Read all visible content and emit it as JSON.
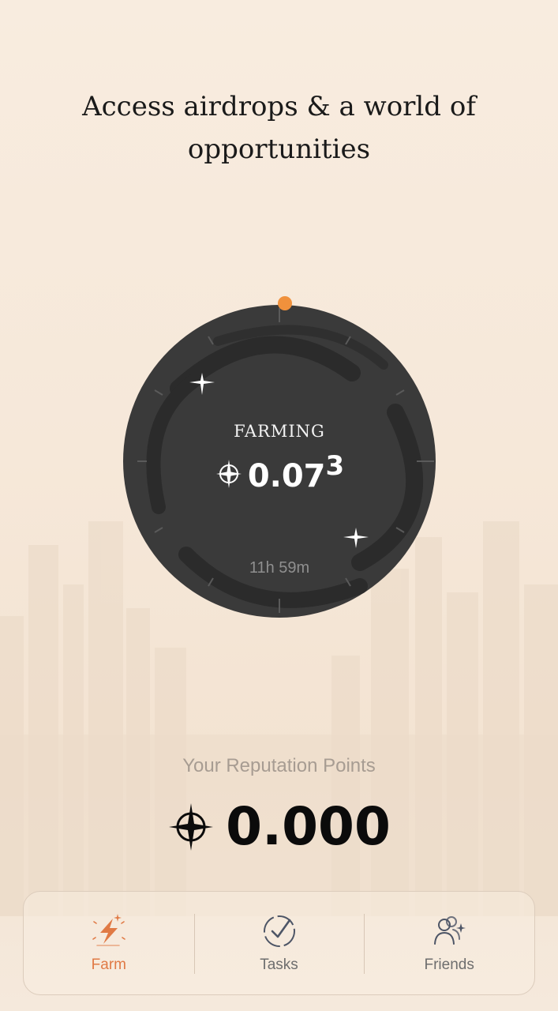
{
  "headline": {
    "line1": "Access airdrops & a world of",
    "line2": "opportunities"
  },
  "dial": {
    "status": "FARMING",
    "value": "0.07",
    "value_superscript": "3",
    "timer": "11h 59m",
    "coin_icon": "sparkle-coin-icon",
    "progress_dot_color": "#f0913c",
    "face_color": "#3a3a3a"
  },
  "reputation": {
    "label": "Your Reputation Points",
    "value": "0.000",
    "coin_icon": "sparkle-coin-icon"
  },
  "nav": {
    "items": [
      {
        "label": "Farm",
        "icon": "farm-lightning-icon",
        "active": true
      },
      {
        "label": "Tasks",
        "icon": "tasks-check-icon",
        "active": false
      },
      {
        "label": "Friends",
        "icon": "friends-icon",
        "active": false
      }
    ],
    "accent_color": "#e07a45"
  }
}
